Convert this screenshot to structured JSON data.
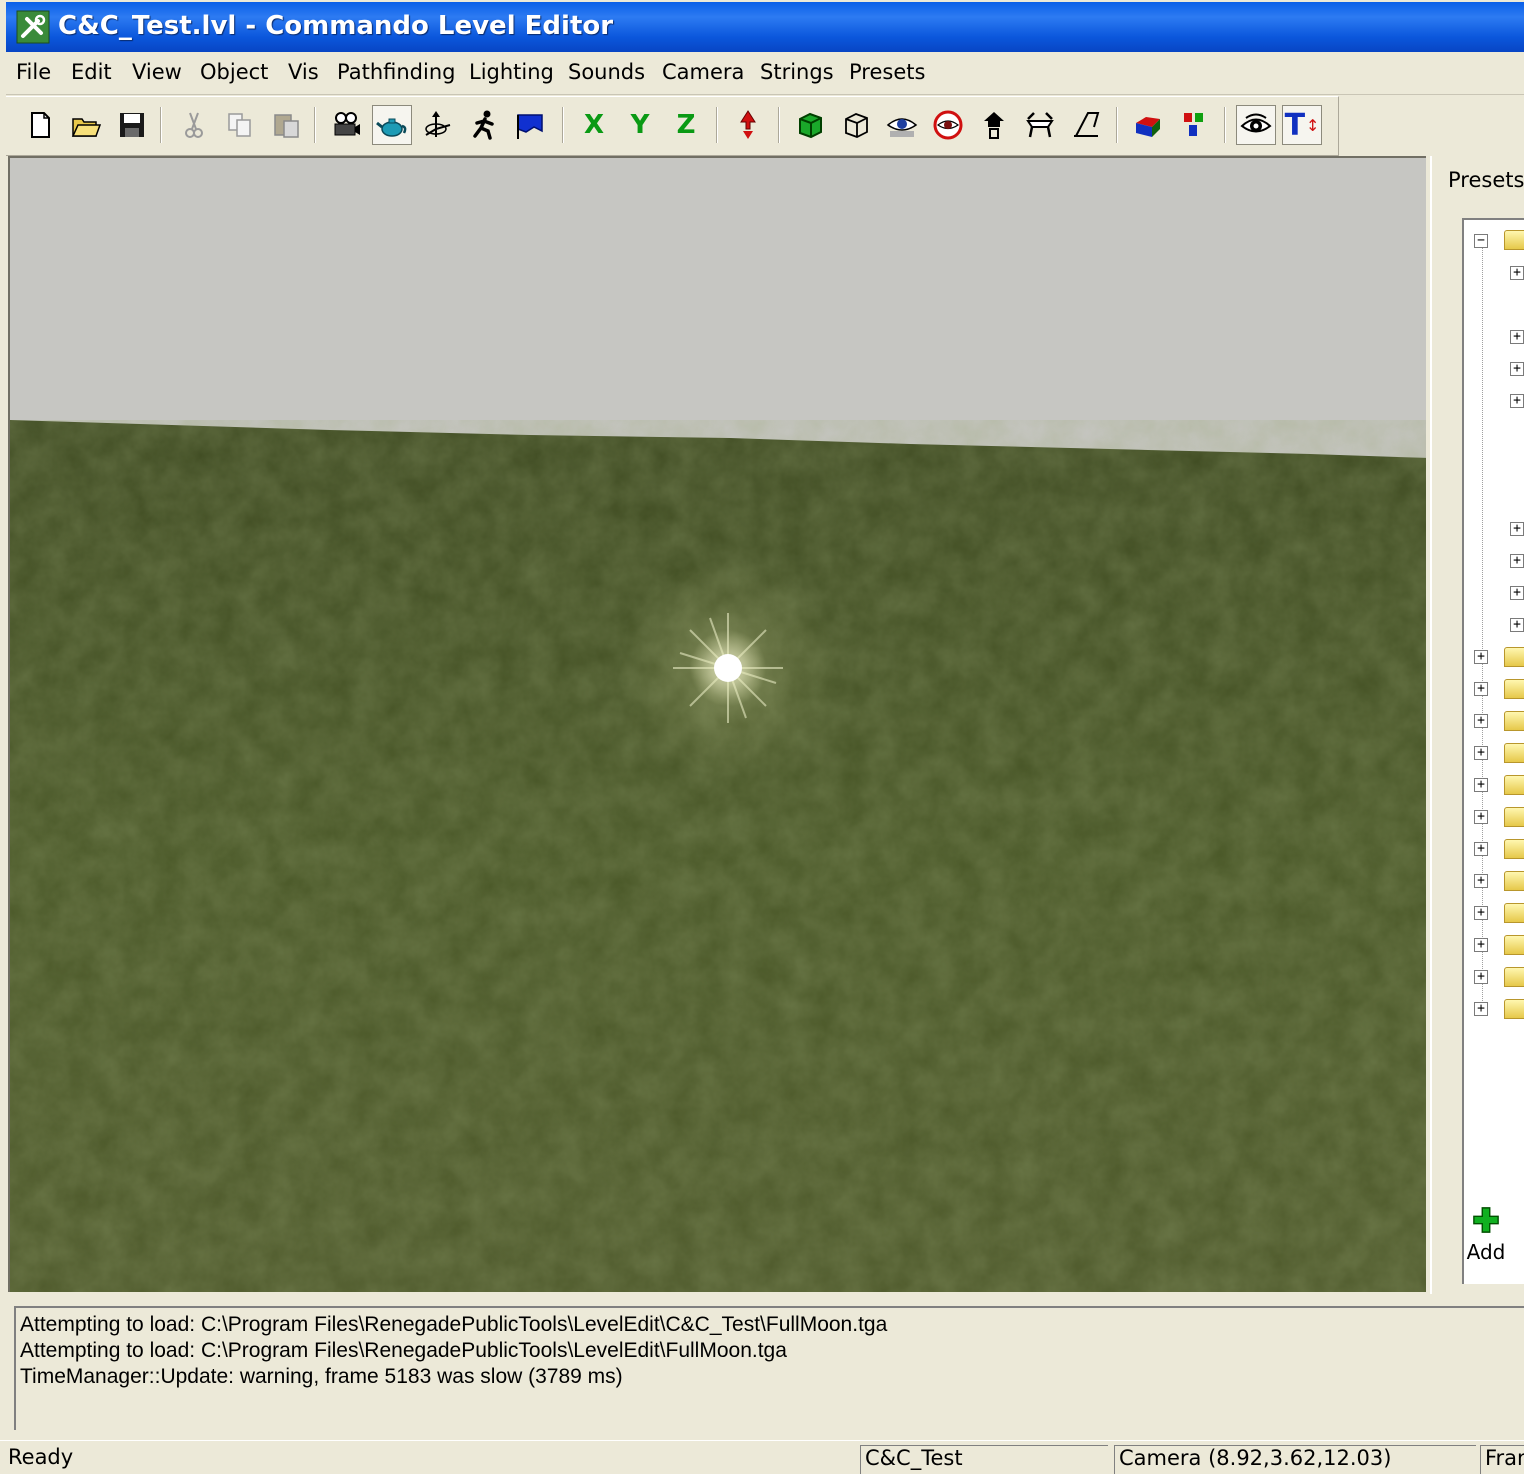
{
  "window": {
    "title": "C&C_Test.lvl - Commando Level Editor"
  },
  "menu": [
    "File",
    "Edit",
    "View",
    "Object",
    "Vis",
    "Pathfinding",
    "Lighting",
    "Sounds",
    "Camera",
    "Strings",
    "Presets"
  ],
  "toolbar": {
    "axis_x": "X",
    "axis_y": "Y",
    "axis_z": "Z",
    "text_tool": "T"
  },
  "presets": {
    "title": "Presets",
    "add_label": "Add"
  },
  "log": {
    "lines": [
      "Attempting to load: C:\\Program Files\\RenegadePublicTools\\LevelEdit\\C&C_Test\\FullMoon.tga",
      "Attempting to load: C:\\Program Files\\RenegadePublicTools\\LevelEdit\\FullMoon.tga",
      "TimeManager::Update: warning, frame 5183 was slow (3789 ms)"
    ]
  },
  "status": {
    "ready": "Ready",
    "level": "C&C_Test",
    "camera": "Camera (8.92,3.62,12.03)",
    "frame": "Fran"
  },
  "colors": {
    "title_bar": "#0a5fe8",
    "ground": "#4a5a28",
    "sky": "#c6c6c2",
    "axis_green": "#0a9a14"
  }
}
